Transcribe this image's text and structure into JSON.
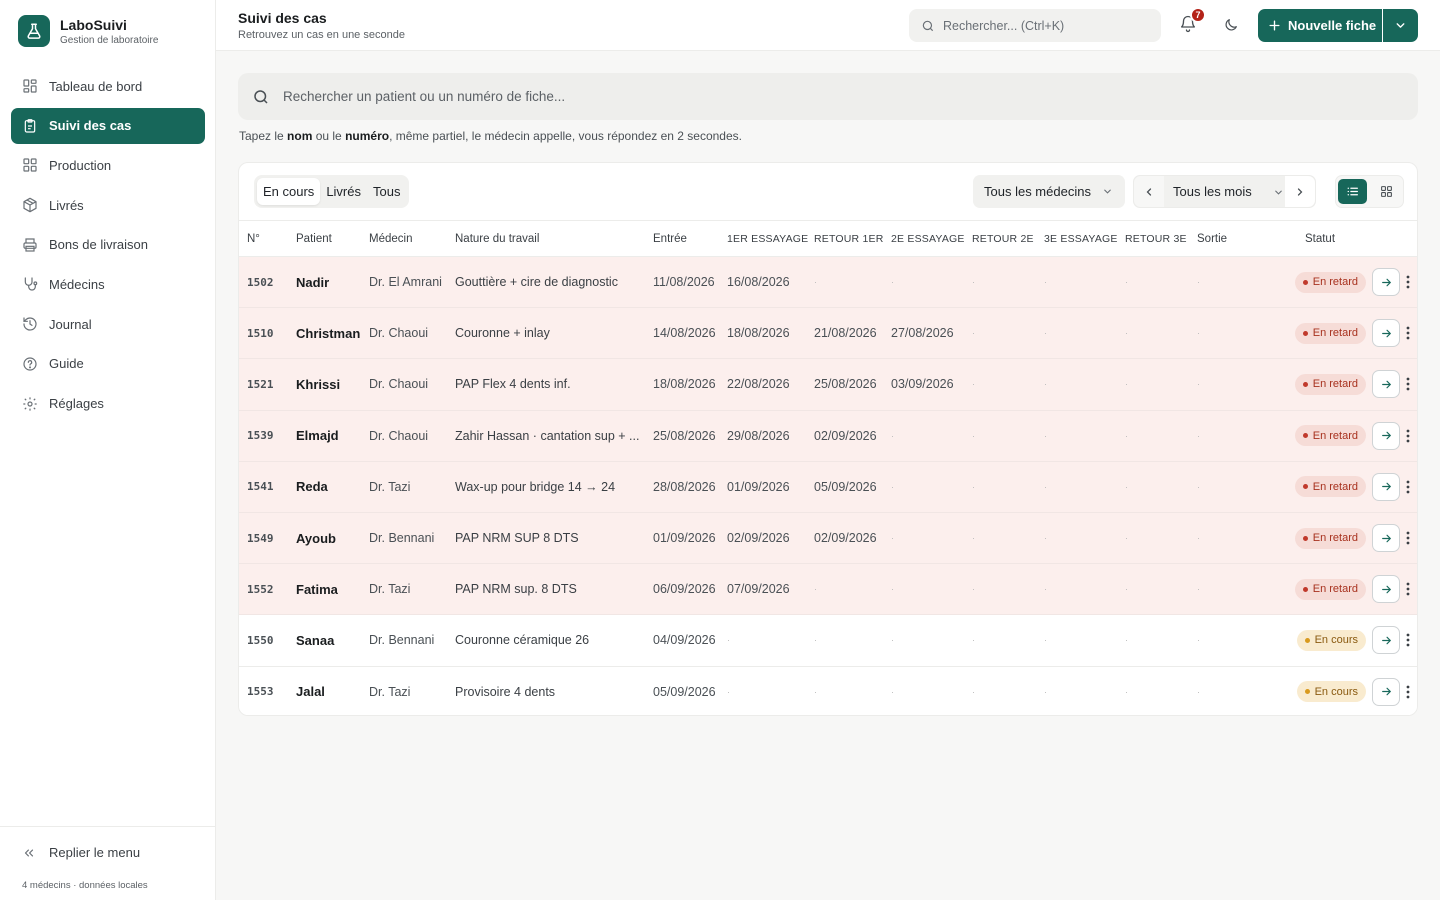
{
  "app": {
    "name": "LaboSuivi",
    "subtitle": "Gestion de laboratoire"
  },
  "sidebar": {
    "items": [
      {
        "label": "Tableau de bord",
        "icon": "dashboard-icon"
      },
      {
        "label": "Suivi des cas",
        "icon": "clipboard-icon",
        "active": true
      },
      {
        "label": "Production",
        "icon": "grid-icon"
      },
      {
        "label": "Livrés",
        "icon": "package-icon"
      },
      {
        "label": "Bons de livraison",
        "icon": "printer-icon"
      },
      {
        "label": "Médecins",
        "icon": "stethoscope-icon"
      },
      {
        "label": "Journal",
        "icon": "history-icon"
      },
      {
        "label": "Guide",
        "icon": "help-circle-icon"
      },
      {
        "label": "Réglages",
        "icon": "gear-icon"
      }
    ],
    "collapse_label": "Replier le menu",
    "footer": "4 médecins · données locales"
  },
  "header": {
    "title": "Suivi des cas",
    "subtitle": "Retrouvez un cas en une seconde",
    "search_placeholder": "Rechercher... (Ctrl+K)",
    "notif_count": "7",
    "new_button": "Nouvelle fiche"
  },
  "main": {
    "search_placeholder": "Rechercher un patient ou un numéro de fiche...",
    "hint": {
      "p1": "Tapez le ",
      "b1": "nom",
      "p2": " ou le ",
      "b2": "numéro",
      "p3": ", même partiel, le médecin appelle, vous répondez en 2 secondes."
    },
    "tabs": [
      "En cours",
      "Livrés",
      "Tous"
    ],
    "active_tab": "En cours",
    "medecin_filter": "Tous les médecins",
    "month_filter": "Tous les mois"
  },
  "table": {
    "columns": [
      "N°",
      "Patient",
      "Médecin",
      "Nature du travail",
      "Entrée",
      "1ER ESSAYAGE",
      "RETOUR 1ER",
      "2E ESSAYAGE",
      "RETOUR 2E",
      "3E ESSAYAGE",
      "RETOUR 3E",
      "Sortie",
      "Statut"
    ],
    "rows": [
      {
        "num": "1502",
        "patient": "Nadir",
        "medecin": "Dr. El Amrani",
        "nature": "Gouttière + cire de diagnostic",
        "entree": "11/08/2026",
        "e1": "16/08/2026",
        "r1": "·",
        "e2": "·",
        "r2": "·",
        "e3": "·",
        "r3": "·",
        "sortie": "·",
        "statut": "En retard",
        "kind": "late"
      },
      {
        "num": "1510",
        "patient": "Christman",
        "medecin": "Dr. Chaoui",
        "nature": "Couronne + inlay",
        "entree": "14/08/2026",
        "e1": "18/08/2026",
        "r1": "21/08/2026",
        "e2": "27/08/2026",
        "r2": "·",
        "e3": "·",
        "r3": "·",
        "sortie": "·",
        "statut": "En retard",
        "kind": "late"
      },
      {
        "num": "1521",
        "patient": "Khrissi",
        "medecin": "Dr. Chaoui",
        "nature": "PAP Flex 4 dents inf.",
        "entree": "18/08/2026",
        "e1": "22/08/2026",
        "r1": "25/08/2026",
        "e2": "03/09/2026",
        "r2": "·",
        "e3": "·",
        "r3": "·",
        "sortie": "·",
        "statut": "En retard",
        "kind": "late"
      },
      {
        "num": "1539",
        "patient": "Elmajd",
        "medecin": "Dr. Chaoui",
        "nature": "Zahir Hassan · cantation sup + ...",
        "entree": "25/08/2026",
        "e1": "29/08/2026",
        "r1": "02/09/2026",
        "e2": "·",
        "r2": "·",
        "e3": "·",
        "r3": "·",
        "sortie": "·",
        "statut": "En retard",
        "kind": "late"
      },
      {
        "num": "1541",
        "patient": "Reda",
        "medecin": "Dr. Tazi",
        "nature": "Wax-up pour bridge 14 → 24",
        "entree": "28/08/2026",
        "e1": "01/09/2026",
        "r1": "05/09/2026",
        "e2": "·",
        "r2": "·",
        "e3": "·",
        "r3": "·",
        "sortie": "·",
        "statut": "En retard",
        "kind": "late"
      },
      {
        "num": "1549",
        "patient": "Ayoub",
        "medecin": "Dr. Bennani",
        "nature": "PAP NRM SUP 8 DTS",
        "entree": "01/09/2026",
        "e1": "02/09/2026",
        "r1": "02/09/2026",
        "e2": "·",
        "r2": "·",
        "e3": "·",
        "r3": "·",
        "sortie": "·",
        "statut": "En retard",
        "kind": "late"
      },
      {
        "num": "1552",
        "patient": "Fatima",
        "medecin": "Dr. Tazi",
        "nature": "PAP NRM sup. 8 DTS",
        "entree": "06/09/2026",
        "e1": "07/09/2026",
        "r1": "·",
        "e2": "·",
        "r2": "·",
        "e3": "·",
        "r3": "·",
        "sortie": "·",
        "statut": "En retard",
        "kind": "late"
      },
      {
        "num": "1550",
        "patient": "Sanaa",
        "medecin": "Dr. Bennani",
        "nature": "Couronne céramique 26",
        "entree": "04/09/2026",
        "e1": "·",
        "r1": "·",
        "e2": "·",
        "r2": "·",
        "e3": "·",
        "r3": "·",
        "sortie": "·",
        "statut": "En cours",
        "kind": "cur"
      },
      {
        "num": "1553",
        "patient": "Jalal",
        "medecin": "Dr. Tazi",
        "nature": "Provisoire 4 dents",
        "entree": "05/09/2026",
        "e1": "·",
        "r1": "·",
        "e2": "·",
        "r2": "·",
        "e3": "·",
        "r3": "·",
        "sortie": "·",
        "statut": "En cours",
        "kind": "cur"
      }
    ]
  },
  "colors": {
    "accent": "#17675a",
    "late_bg": "#fcefed",
    "late_text": "#a8321f",
    "cur_text": "#8a5a10"
  }
}
